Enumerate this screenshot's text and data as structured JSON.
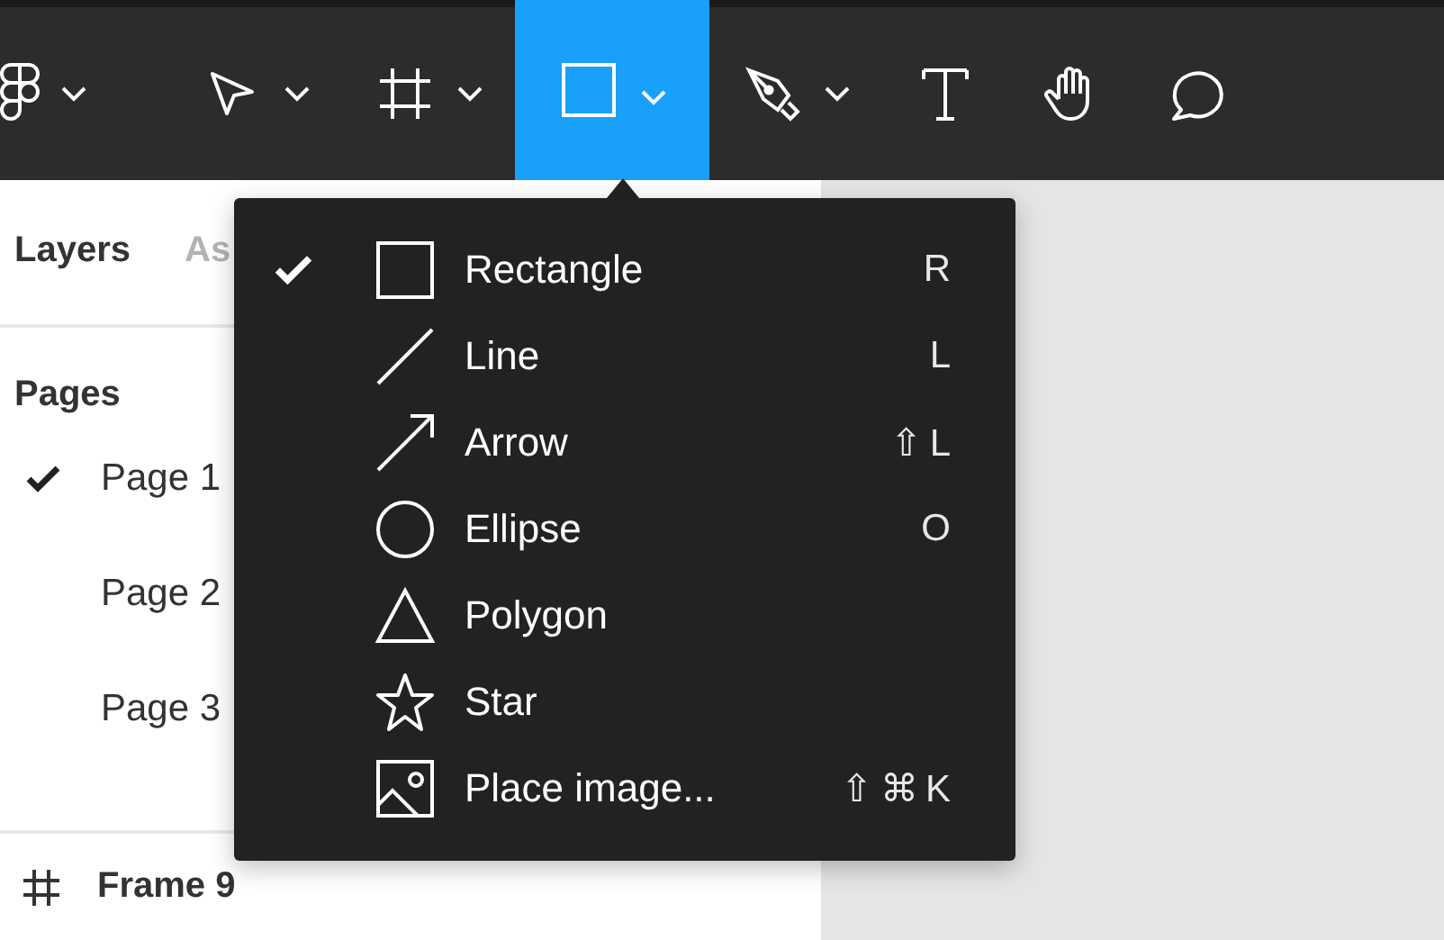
{
  "toolbar": {
    "tools": [
      {
        "kind": "logo",
        "selected": false,
        "dropdown": true
      },
      {
        "kind": "move",
        "selected": false,
        "dropdown": true
      },
      {
        "kind": "frame",
        "selected": false,
        "dropdown": true
      },
      {
        "kind": "shape",
        "selected": true,
        "dropdown": true
      },
      {
        "kind": "pen",
        "selected": false,
        "dropdown": true
      },
      {
        "kind": "text",
        "selected": false,
        "dropdown": false
      },
      {
        "kind": "hand",
        "selected": false,
        "dropdown": false
      },
      {
        "kind": "comment",
        "selected": false,
        "dropdown": false
      }
    ]
  },
  "panel": {
    "tabs": [
      {
        "label": "Layers",
        "selected": true
      },
      {
        "label": "As",
        "selected": false
      }
    ],
    "pages_title": "Pages",
    "pages": [
      {
        "label": "Page 1",
        "selected": true
      },
      {
        "label": "Page 2",
        "selected": false
      },
      {
        "label": "Page 3",
        "selected": false
      }
    ],
    "layers": [
      {
        "kind": "frame",
        "label": "Frame 9"
      }
    ]
  },
  "menu": {
    "items": [
      {
        "kind": "rectangle",
        "label": "Rectangle",
        "shortcut": "R",
        "checked": true
      },
      {
        "kind": "line",
        "label": "Line",
        "shortcut": "L",
        "checked": false
      },
      {
        "kind": "arrow",
        "label": "Arrow",
        "shortcut": "⇧L",
        "checked": false
      },
      {
        "kind": "ellipse",
        "label": "Ellipse",
        "shortcut": "O",
        "checked": false
      },
      {
        "kind": "polygon",
        "label": "Polygon",
        "checked": false
      },
      {
        "kind": "star",
        "label": "Star",
        "checked": false
      },
      {
        "kind": "image",
        "label": "Place image...",
        "shortcut": "⇧⌘K",
        "checked": false
      }
    ]
  }
}
